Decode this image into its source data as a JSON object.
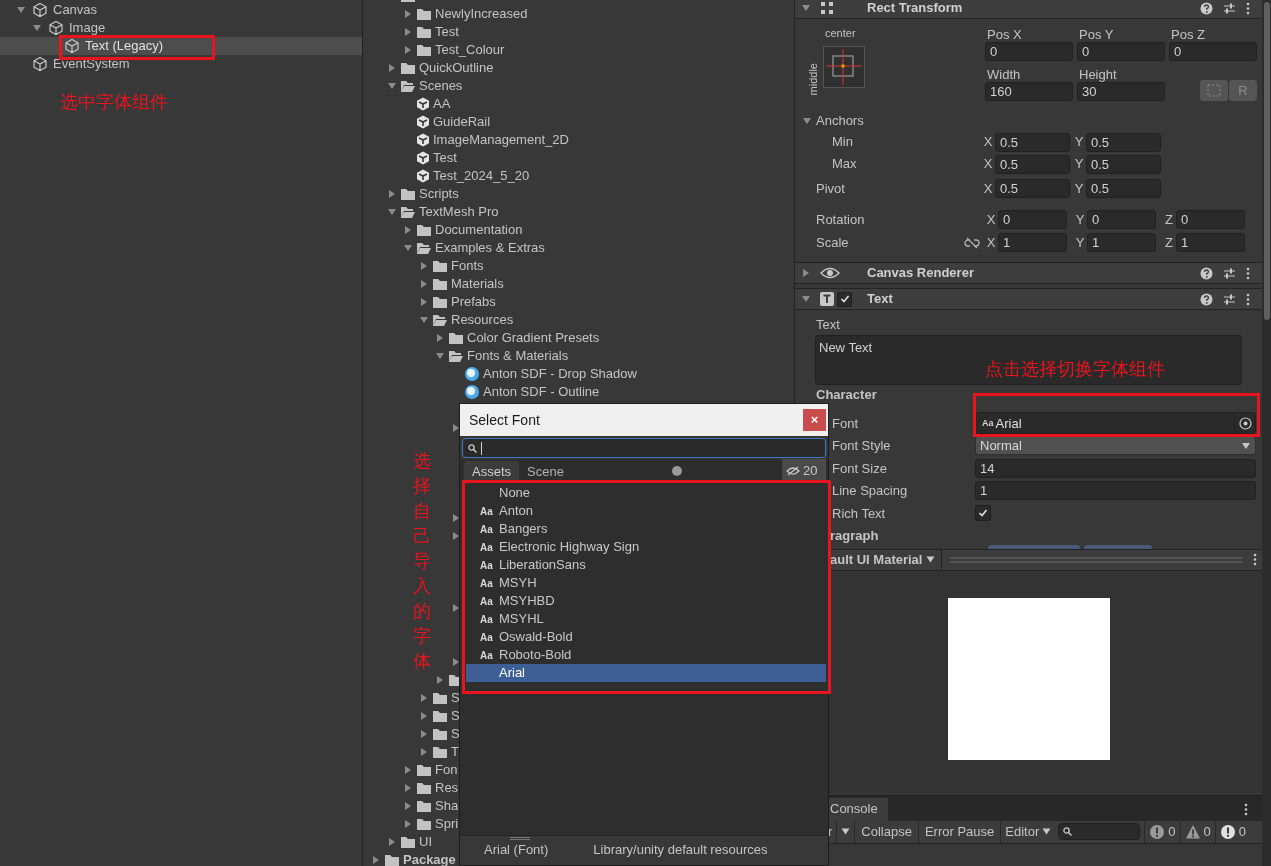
{
  "hierarchy": {
    "items": [
      {
        "label": "Canvas",
        "expanded": true,
        "selected": false,
        "children": [
          {
            "label": "Image",
            "expanded": true,
            "selected": false,
            "children": [
              {
                "label": "Text (Legacy)",
                "selected": true
              }
            ]
          }
        ]
      },
      {
        "label": "EventSystem",
        "selected": false
      }
    ]
  },
  "project": {
    "items": [
      {
        "kind": "offscreen",
        "children": [
          {
            "kind": "folder",
            "children": [
              {
                "kind": "folder",
                "label": "NewlyIncreased",
                "expanded": false
              },
              {
                "kind": "folder",
                "label": "Test",
                "expanded": false
              },
              {
                "kind": "folder",
                "label": "Test_Colour",
                "expanded": false
              }
            ]
          },
          {
            "kind": "folder",
            "label": "QuickOutline",
            "expanded": false
          },
          {
            "kind": "folder",
            "label": "Scenes",
            "expanded": true,
            "children": [
              {
                "kind": "scene",
                "label": "AA"
              },
              {
                "kind": "scene",
                "label": "GuideRail"
              },
              {
                "kind": "scene",
                "label": "ImageManagement_2D"
              },
              {
                "kind": "scene",
                "label": "Test"
              },
              {
                "kind": "scene",
                "label": "Test_2024_5_20"
              }
            ]
          },
          {
            "kind": "folder",
            "label": "Scripts",
            "expanded": false
          },
          {
            "kind": "folder",
            "label": "TextMesh Pro",
            "expanded": true,
            "children": [
              {
                "kind": "folder",
                "label": "Documentation",
                "expanded": false
              },
              {
                "kind": "folder",
                "label": "Examples & Extras",
                "expanded": true,
                "children": [
                  {
                    "kind": "folder",
                    "label": "Fonts",
                    "expanded": false
                  },
                  {
                    "kind": "folder",
                    "label": "Materials",
                    "expanded": false
                  },
                  {
                    "kind": "folder",
                    "label": "Prefabs",
                    "expanded": false
                  },
                  {
                    "kind": "folder",
                    "label": "Resources",
                    "expanded": true,
                    "children": [
                      {
                        "kind": "folder",
                        "label": "Color Gradient Presets",
                        "expanded": false
                      },
                      {
                        "kind": "folder",
                        "label": "Fonts & Materials",
                        "expanded": true,
                        "children": [
                          {
                            "kind": "font-asset",
                            "label": "Anton SDF - Drop Shadow"
                          },
                          {
                            "kind": "font-asset",
                            "label": "Anton SDF - Outline"
                          },
                          {
                            "kind": "covered"
                          },
                          {
                            "kind": "covered",
                            "expanded": false
                          },
                          {
                            "kind": "covered"
                          },
                          {
                            "kind": "covered"
                          },
                          {
                            "kind": "covered"
                          },
                          {
                            "kind": "covered"
                          },
                          {
                            "kind": "covered",
                            "expanded": false
                          },
                          {
                            "kind": "covered",
                            "expanded": false
                          },
                          {
                            "kind": "covered"
                          },
                          {
                            "kind": "covered"
                          },
                          {
                            "kind": "covered"
                          },
                          {
                            "kind": "covered",
                            "expanded": false
                          },
                          {
                            "kind": "covered"
                          },
                          {
                            "kind": "covered"
                          },
                          {
                            "kind": "covered",
                            "expanded": false
                          }
                        ]
                      },
                      {
                        "kind": "folder",
                        "expanded": false
                      }
                    ]
                  },
                  {
                    "kind": "folder",
                    "label": "S",
                    "expanded": false
                  },
                  {
                    "kind": "folder",
                    "label": "S",
                    "expanded": false
                  },
                  {
                    "kind": "folder",
                    "label": "S",
                    "expanded": false
                  },
                  {
                    "kind": "folder",
                    "label": "T",
                    "expanded": false
                  }
                ]
              },
              {
                "kind": "folder",
                "label": "Fon",
                "expanded": false
              },
              {
                "kind": "folder",
                "label": "Res",
                "expanded": false
              },
              {
                "kind": "folder",
                "label": "Sha",
                "expanded": false
              },
              {
                "kind": "folder",
                "label": "Spri",
                "expanded": false
              }
            ]
          },
          {
            "kind": "folder",
            "label": "UI",
            "expanded": false
          }
        ]
      },
      {
        "kind": "folder",
        "label": "Package",
        "expanded": false,
        "bold": true
      }
    ]
  },
  "inspector": {
    "rect_transform": {
      "title": "Rect Transform",
      "expanded": true,
      "anchor_h": "center",
      "anchor_v": "middle",
      "position": [
        {
          "label": "Pos X",
          "value": "0"
        },
        {
          "label": "Pos Y",
          "value": "0"
        },
        {
          "label": "Pos Z",
          "value": "0"
        }
      ],
      "size": [
        {
          "label": "Width",
          "value": "160"
        },
        {
          "label": "Height",
          "value": "30"
        }
      ],
      "raw_button": "R",
      "anchors": {
        "label": "Anchors",
        "expanded": true,
        "rows": [
          {
            "label": "Min",
            "fields": [
              {
                "axis": "X",
                "value": "0.5"
              },
              {
                "axis": "Y",
                "value": "0.5"
              }
            ]
          },
          {
            "label": "Max",
            "fields": [
              {
                "axis": "X",
                "value": "0.5"
              },
              {
                "axis": "Y",
                "value": "0.5"
              }
            ]
          }
        ]
      },
      "pivot": {
        "label": "Pivot",
        "fields": [
          {
            "axis": "X",
            "value": "0.5"
          },
          {
            "axis": "Y",
            "value": "0.5"
          }
        ]
      },
      "rotation": {
        "label": "Rotation",
        "fields": [
          {
            "axis": "X",
            "value": "0"
          },
          {
            "axis": "Y",
            "value": "0"
          },
          {
            "axis": "Z",
            "value": "0"
          }
        ]
      },
      "scale": {
        "label": "Scale",
        "fields": [
          {
            "axis": "X",
            "value": "1"
          },
          {
            "axis": "Y",
            "value": "1"
          },
          {
            "axis": "Z",
            "value": "1"
          }
        ]
      }
    },
    "components": [
      {
        "kind": "renderer",
        "title": "Canvas Renderer",
        "expanded": false
      },
      {
        "kind": "text",
        "title": "Text",
        "expanded": true,
        "enabled": true
      }
    ],
    "text_component": {
      "text_label": "Text",
      "text_value": "New Text",
      "section": "Character",
      "fields": [
        {
          "kind": "object",
          "label": "Font",
          "icon": "Aa",
          "value": "Arial"
        },
        {
          "kind": "dropdown",
          "label": "Font Style",
          "value": "Normal"
        },
        {
          "kind": "number",
          "label": "Font Size",
          "value": "14"
        },
        {
          "kind": "number",
          "label": "Line Spacing",
          "value": "1"
        },
        {
          "kind": "checkbox",
          "label": "Rich Text",
          "checked": true
        }
      ],
      "next_section": "ragraph"
    },
    "preview": {
      "material": "ault UI Material"
    }
  },
  "console": {
    "tab": "Console",
    "clear": "r",
    "buttons": [
      "Collapse",
      "Error Pause"
    ],
    "editor": "Editor",
    "counts": [
      {
        "kind": "info",
        "value": "0"
      },
      {
        "kind": "warning",
        "value": "0"
      },
      {
        "kind": "error",
        "value": "0"
      }
    ]
  },
  "dialog": {
    "title": "Select Font",
    "close": "×",
    "tabs": [
      {
        "label": "Assets",
        "selected": true
      },
      {
        "label": "Scene",
        "selected": false
      }
    ],
    "hidden_count": "20",
    "items": [
      {
        "label": "None",
        "selected": false
      },
      {
        "icon": "Aa",
        "label": "Anton",
        "selected": false
      },
      {
        "icon": "Aa",
        "label": "Bangers",
        "selected": false
      },
      {
        "icon": "Aa",
        "label": "Electronic Highway Sign",
        "selected": false
      },
      {
        "icon": "Aa",
        "label": "LiberationSans",
        "selected": false
      },
      {
        "icon": "Aa",
        "label": "MSYH",
        "selected": false
      },
      {
        "icon": "Aa",
        "label": "MSYHBD",
        "selected": false
      },
      {
        "icon": "Aa",
        "label": "MSYHL",
        "selected": false
      },
      {
        "icon": "Aa",
        "label": "Oswald-Bold",
        "selected": false
      },
      {
        "icon": "Aa",
        "label": "Roboto-Bold",
        "selected": false
      },
      {
        "label": "Arial",
        "selected": true
      }
    ],
    "status": "Arial (Font)",
    "path": "Library/unity default resources"
  },
  "annotations": [
    {
      "kind": "horizontal",
      "text": "选中字体组件"
    },
    {
      "kind": "horizontal",
      "text": "点击选择切换字体组件"
    },
    {
      "kind": "vertical",
      "text": "选择自己导入的字体"
    }
  ]
}
